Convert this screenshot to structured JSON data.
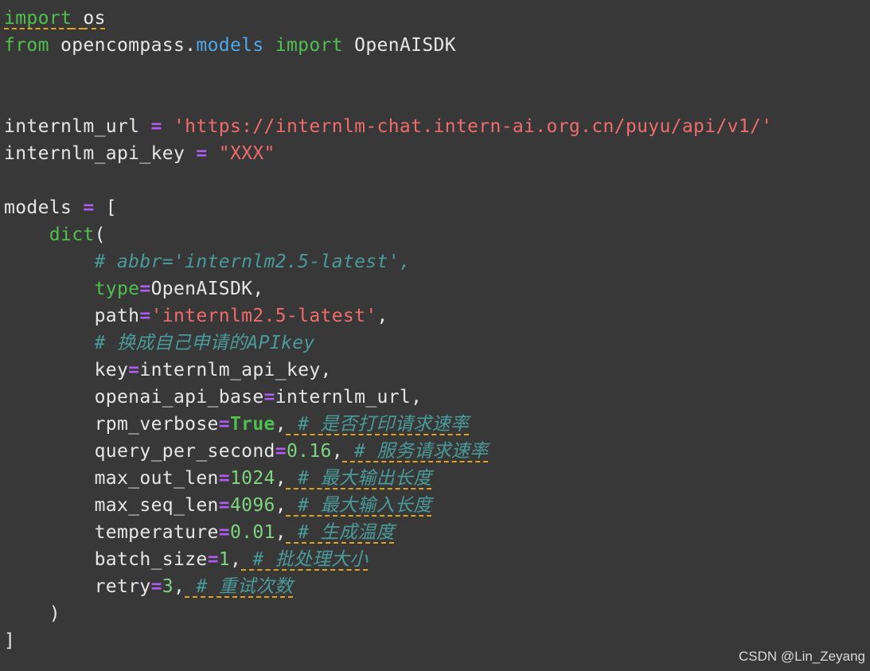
{
  "code": {
    "line1": {
      "import_kw": "import",
      "space": " ",
      "module": "os"
    },
    "line2": {
      "from_kw": "from",
      "pkg": " opencompass.",
      "submod": "models",
      "sp": " ",
      "import_kw": "import",
      "name": " OpenAISDK"
    },
    "line5": {
      "var": "internlm_url ",
      "op": "=",
      "sp": " ",
      "value": "'https://internlm-chat.intern-ai.org.cn/puyu/api/v1/'"
    },
    "line6": {
      "var": "internlm_api_key ",
      "op": "=",
      "sp": " ",
      "value": "\"XXX\""
    },
    "line8": {
      "var": "models ",
      "op": "=",
      "bracket": " ["
    },
    "line9": {
      "indent": "    ",
      "func": "dict",
      "paren": "("
    },
    "line10": {
      "indent": "        ",
      "comment": "# abbr='internlm2.5-latest',"
    },
    "line11": {
      "indent": "        ",
      "key": "type",
      "op": "=",
      "value": "OpenAISDK",
      "trail": ","
    },
    "line12": {
      "indent": "        ",
      "key": "path",
      "op": "=",
      "value": "'internlm2.5-latest'",
      "trail": ","
    },
    "line13": {
      "indent": "        ",
      "comment": "# 换成自己申请的APIkey"
    },
    "line14": {
      "indent": "        ",
      "key": "key",
      "op": "=",
      "value": "internlm_api_key",
      "trail": ","
    },
    "line15": {
      "indent": "        ",
      "key": "openai_api_base",
      "op": "=",
      "value": "internlm_url",
      "trail": ","
    },
    "line16": {
      "indent": "        ",
      "key": "rpm_verbose",
      "op": "=",
      "value": "True",
      "trail": ",",
      "comment": " # 是否打印请求速率"
    },
    "line17": {
      "indent": "        ",
      "key": "query_per_second",
      "op": "=",
      "value": "0.16",
      "trail": ",",
      "comment": " # 服务请求速率"
    },
    "line18": {
      "indent": "        ",
      "key": "max_out_len",
      "op": "=",
      "value": "1024",
      "trail": ",",
      "comment": " # 最大输出长度"
    },
    "line19": {
      "indent": "        ",
      "key": "max_seq_len",
      "op": "=",
      "value": "4096",
      "trail": ",",
      "comment": " # 最大输入长度"
    },
    "line20": {
      "indent": "        ",
      "key": "temperature",
      "op": "=",
      "value": "0.01",
      "trail": ",",
      "comment": " # 生成温度"
    },
    "line21": {
      "indent": "        ",
      "key": "batch_size",
      "op": "=",
      "value": "1",
      "trail": ",",
      "comment": " # 批处理大小"
    },
    "line22": {
      "indent": "        ",
      "key": "retry",
      "op": "=",
      "value": "3",
      "trail": ",",
      "comment": " # 重试次数"
    },
    "line23": {
      "indent": "    ",
      "paren": ")"
    },
    "line24": {
      "bracket": "]"
    }
  },
  "watermark": "CSDN @Lin_Zeyang",
  "colors": {
    "background": "#383838",
    "keyword": "#4fbf4f",
    "operator": "#b05cf0",
    "string": "#ef6c6c",
    "attribute": "#4ea8e8",
    "comment": "#4a9a9a",
    "number": "#7fd47f",
    "squiggle": "#e0a020"
  }
}
